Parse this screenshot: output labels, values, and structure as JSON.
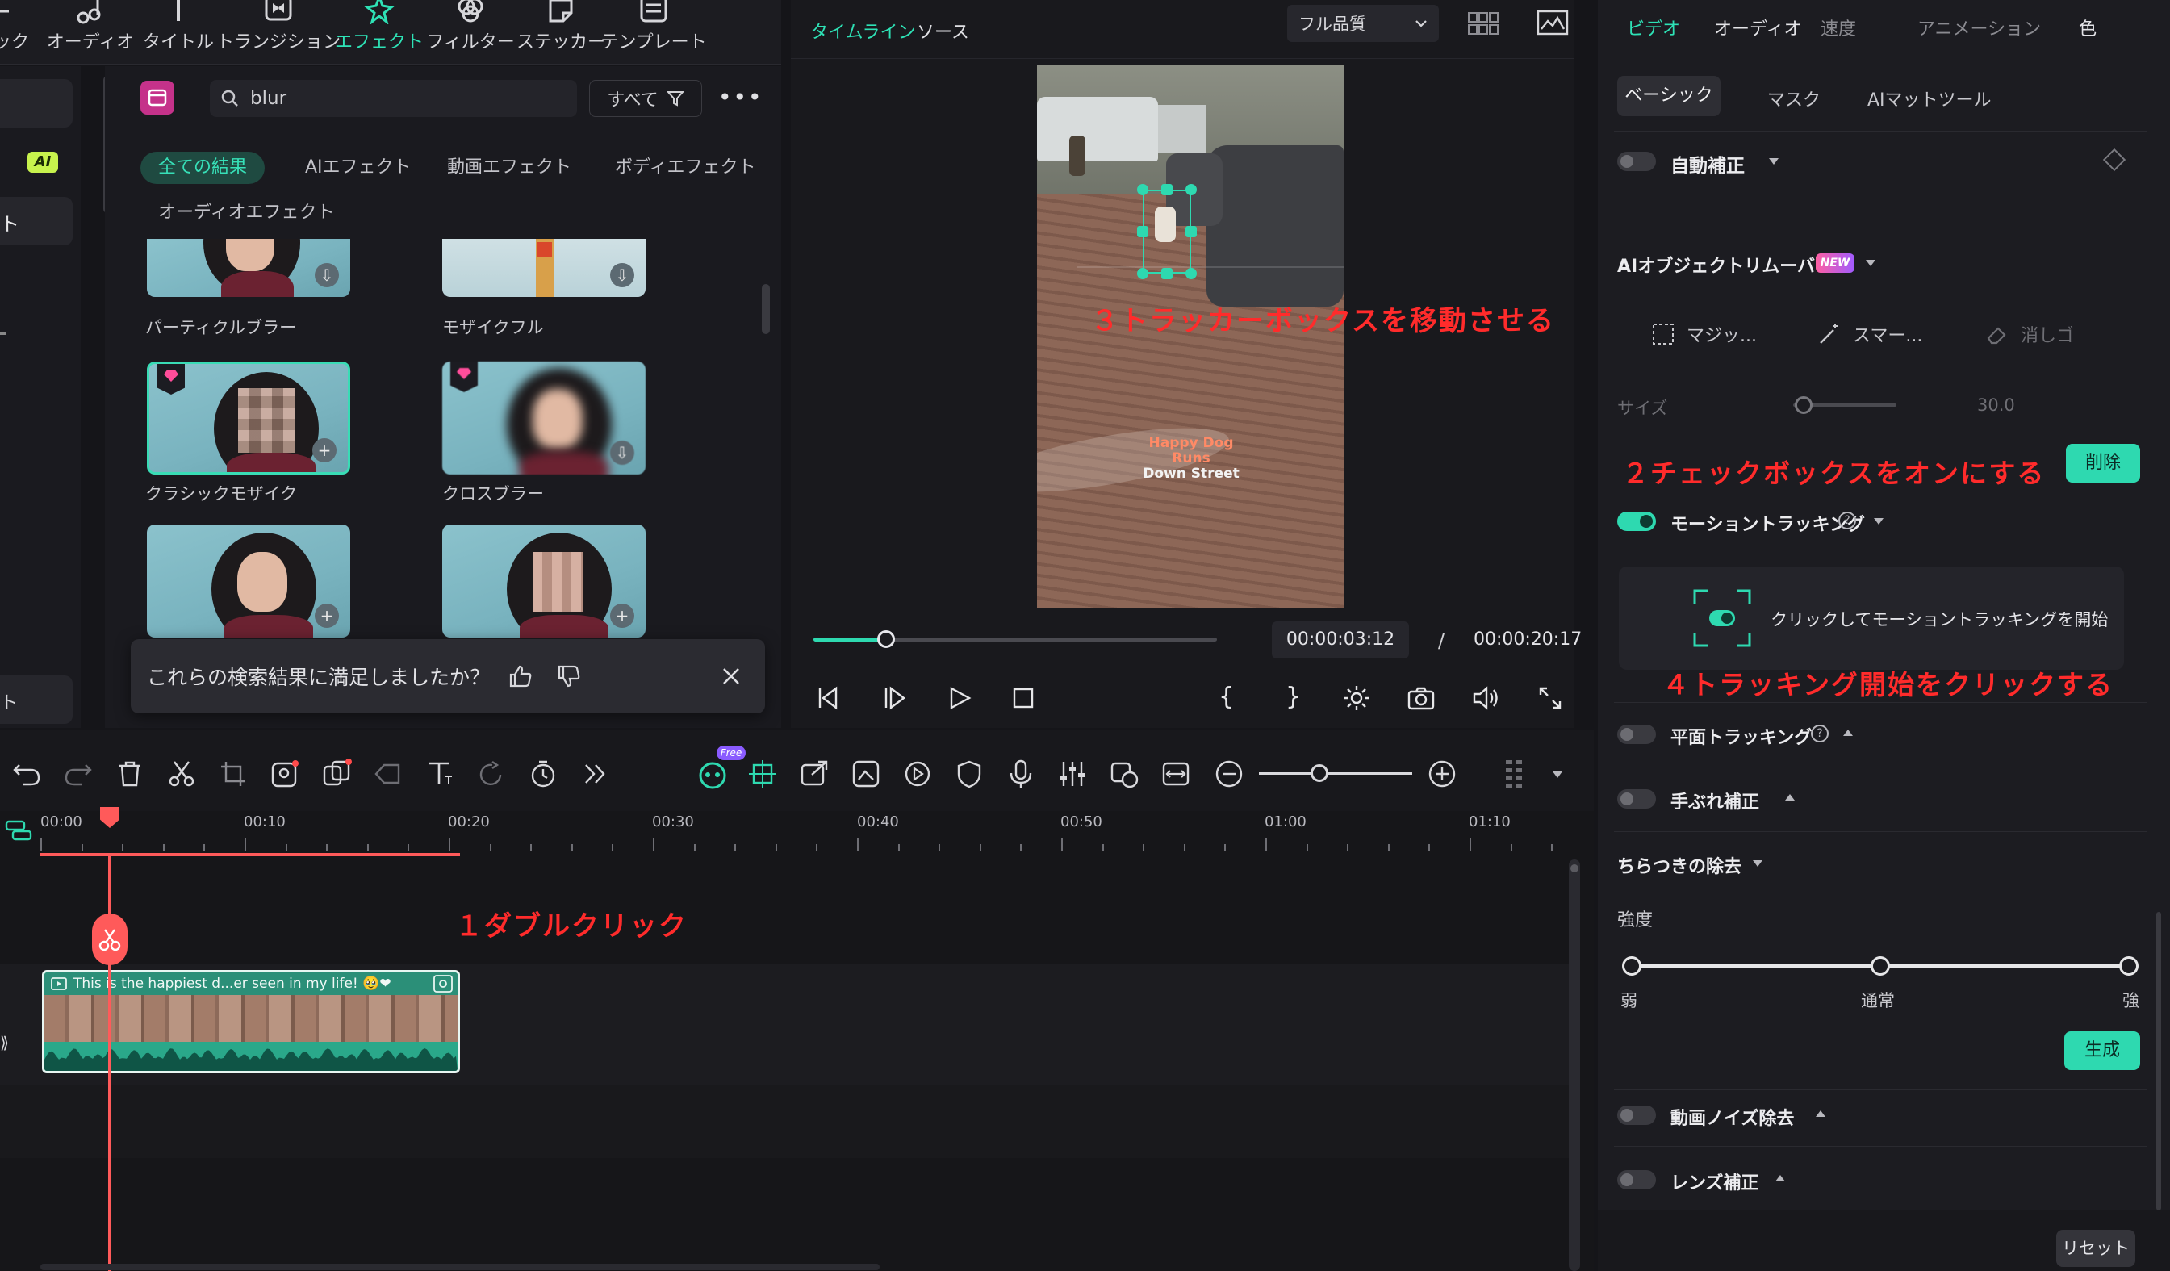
{
  "toolbar": {
    "items": [
      {
        "label": "ック",
        "icon": "partial-icon"
      },
      {
        "label": "オーディオ",
        "icon": "music-note-icon"
      },
      {
        "label": "タイトル",
        "icon": "title-icon"
      },
      {
        "label": "トランジション",
        "icon": "transition-icon"
      },
      {
        "label": "エフェクト",
        "icon": "effects-icon"
      },
      {
        "label": "フィルター",
        "icon": "filter-icon"
      },
      {
        "label": "ステッカー",
        "icon": "sticker-icon"
      },
      {
        "label": "テンプレート",
        "icon": "template-icon"
      }
    ]
  },
  "left_nav": {
    "ai_badge": "AI",
    "item_ト": "ト",
    "item_ト_bottom": "ト"
  },
  "effects": {
    "search_value": "blur",
    "filter_label": "すべて",
    "tabs": [
      "全ての結果",
      "AIエフェクト",
      "動画エフェクト",
      "ボディエフェクト",
      "オーディオエフェクト"
    ],
    "items": [
      {
        "label": "パーティクルブラー"
      },
      {
        "label": "モザイクフル"
      },
      {
        "label": "クラシックモザイク"
      },
      {
        "label": "クロスブラー"
      },
      {
        "label": ""
      },
      {
        "label": ""
      }
    ],
    "feedback_text": "これらの検索結果に満足しましたか？"
  },
  "preview": {
    "tab_timeline": "タイムライン",
    "tab_source": "ソース",
    "quality": "フル品質",
    "video_caption_line1": "Happy Dog Runs",
    "video_caption_line2": "Down Street",
    "current_time": "00:00:03:12",
    "separator": "/",
    "total_time": "00:00:20:17",
    "progress": 0.18
  },
  "right_panel": {
    "tabs": [
      "ビデオ",
      "オーディオ",
      "速度",
      "アニメーション",
      "色"
    ],
    "subtabs": [
      "ベーシック",
      "マスク",
      "AIマットツール"
    ],
    "auto_correct": "自動補正",
    "ai_object_remover": "AIオブジェクトリムーバー",
    "new_badge": "NEW",
    "tool_magic": "マジッ...",
    "tool_smart": "スマー...",
    "tool_erase": "消しゴ",
    "size_label": "サイズ",
    "size_value": "30.0",
    "delete_button": "削除",
    "motion_tracking": "モーショントラッキング",
    "start_tracking": "クリックしてモーショントラッキングを開始",
    "planar_tracking": "平面トラッキング",
    "stabilization": "手ぶれ補正",
    "flicker_removal": "ちらつきの除去",
    "strength_label": "強度",
    "strength_low": "弱",
    "strength_mid": "通常",
    "strength_high": "強",
    "generate_button": "生成",
    "video_denoise": "動画ノイズ除去",
    "lens_correction": "レンズ補正",
    "reset_button": "リセット"
  },
  "annotations": {
    "step1": "１ダブルクリック",
    "step2": "２チェックボックスをオンにする",
    "step3": "３トラッカーボックスを移動させる",
    "step4": "４トラッキング開始をクリックする"
  },
  "timeline": {
    "ruler": [
      "00:00",
      "00:10",
      "00:20",
      "00:30",
      "00:40",
      "00:50",
      "01:00",
      "01:10"
    ],
    "clip_title": "This is the happiest d...er seen in my life! 🥹❤",
    "free_badge": "Free"
  },
  "colors": {
    "accent": "#2ed9b0",
    "annotation": "#ff2b2b",
    "playhead": "#ff5a5a",
    "clip": "#2aa88a"
  }
}
